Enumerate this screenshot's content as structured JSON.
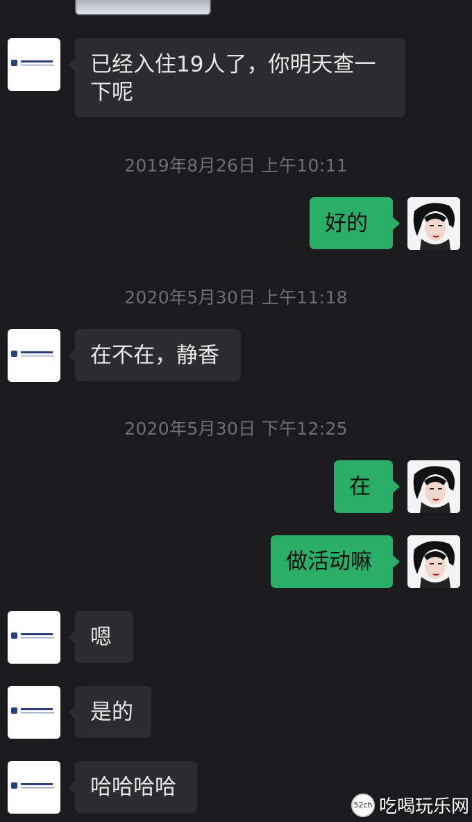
{
  "chat": {
    "messages": [
      {
        "from": "contact",
        "text": "已经入住19人了，你明天查一下呢"
      },
      {
        "from": "me",
        "text": "好的"
      },
      {
        "from": "contact",
        "text": "在不在，静香"
      },
      {
        "from": "me",
        "text": "在"
      },
      {
        "from": "me",
        "text": "做活动嘛"
      },
      {
        "from": "contact",
        "text": "嗯"
      },
      {
        "from": "contact",
        "text": "是的"
      },
      {
        "from": "contact",
        "text": "哈哈哈哈"
      }
    ],
    "timestamps": [
      "2019年8月26日 上午10:11",
      "2020年5月30日 上午11:18",
      "2020年5月30日 下午12:25"
    ]
  },
  "avatars": {
    "contact_icon": "company-logo-icon",
    "me_icon": "portrait-photo-icon"
  },
  "watermark": {
    "badge": "52ch",
    "text": "吃喝玩乐网"
  },
  "colors": {
    "background": "#1b1b1d",
    "incoming_bubble": "#2c2c2e",
    "outgoing_bubble": "#2aae67",
    "timestamp_text": "#6f6f72"
  }
}
